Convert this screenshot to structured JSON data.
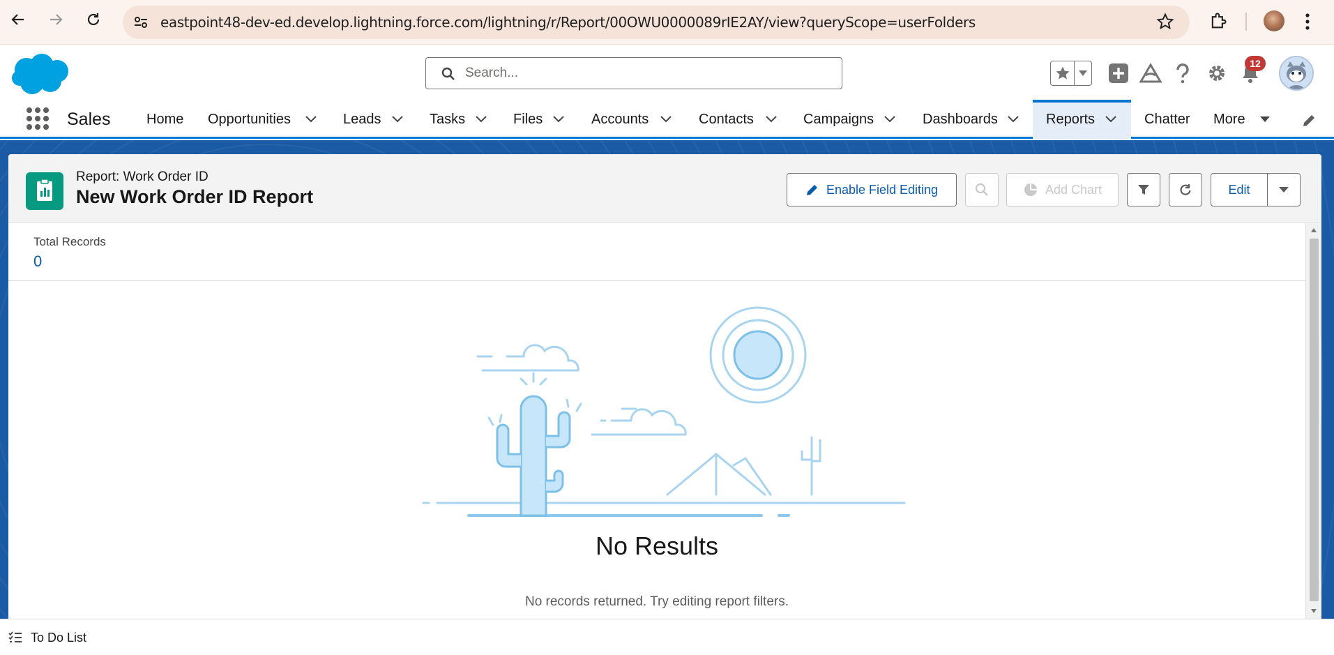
{
  "browser": {
    "url": "eastpoint48-dev-ed.develop.lightning.force.com/lightning/r/Report/00OWU0000089rIE2AY/view?queryScope=userFolders"
  },
  "header": {
    "search_placeholder": "Search...",
    "notification_count": "12"
  },
  "nav": {
    "app_name": "Sales",
    "items": [
      {
        "label": "Home"
      },
      {
        "label": "Opportunities"
      },
      {
        "label": "Leads"
      },
      {
        "label": "Tasks"
      },
      {
        "label": "Files"
      },
      {
        "label": "Accounts"
      },
      {
        "label": "Contacts"
      },
      {
        "label": "Campaigns"
      },
      {
        "label": "Dashboards"
      },
      {
        "label": "Reports"
      },
      {
        "label": "Chatter"
      },
      {
        "label": "More"
      }
    ],
    "active": "Reports"
  },
  "report": {
    "type_label": "Report: Work Order ID",
    "title": "New Work Order ID Report",
    "buttons": {
      "enable_field_editing": "Enable Field Editing",
      "add_chart": "Add Chart",
      "edit": "Edit"
    },
    "total_records_label": "Total Records",
    "total_records_value": "0",
    "empty_title": "No Results",
    "empty_message": "No records returned. Try editing report filters."
  },
  "utility": {
    "todo_label": "To Do List"
  },
  "colors": {
    "brand": "#0176d3",
    "report_icon": "#069a80",
    "page_bg": "#1b5ba6",
    "badge": "#c23934"
  }
}
